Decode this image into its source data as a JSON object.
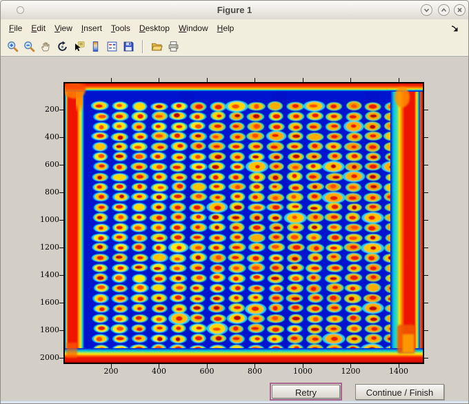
{
  "window": {
    "title": "Figure 1",
    "controls": {
      "menu": "window-menu",
      "minimize": "minimize",
      "maximize": "maximize",
      "close": "close"
    }
  },
  "menubar": {
    "items": [
      "File",
      "Edit",
      "View",
      "Insert",
      "Tools",
      "Desktop",
      "Window",
      "Help"
    ],
    "overflow": "dock-figure-arrow"
  },
  "toolbar": {
    "group1": [
      "zoom-in",
      "zoom-out",
      "pan",
      "rotate-3d",
      "data-cursor",
      "insert-colorbar",
      "insert-legend",
      "save-figure"
    ],
    "group2": [
      "open-file",
      "print-figure"
    ]
  },
  "plot": {
    "x_ticks": [
      200,
      400,
      600,
      800,
      1000,
      1200,
      1400
    ],
    "y_ticks": [
      200,
      400,
      600,
      800,
      1000,
      1200,
      1400,
      1600,
      1800,
      2000
    ],
    "grid": {
      "cols": 16,
      "rows": 25
    },
    "colors": {
      "background": "#0014d0",
      "halo": [
        "#00d2f0",
        "#16dcd4",
        "#2fe0b4",
        "#52e292",
        "#7ce66e"
      ],
      "ring": [
        "#ffe80a",
        "#ffd800",
        "#ffc400",
        "#ffae00",
        "#ff9a00"
      ],
      "core_red": "#e81c00",
      "core_dark": "#bb0600",
      "core_hot": "#ff4e00",
      "edge_red": "#ee1400",
      "edge_orange": "#ff9000",
      "edge_yellow": "#ffe000",
      "edge_cyan": "#00c8e0"
    }
  },
  "chart_data": {
    "type": "heatmap",
    "title": "",
    "xlabel": "",
    "ylabel": "",
    "x_ticks": [
      200,
      400,
      600,
      800,
      1000,
      1200,
      1400
    ],
    "y_ticks": [
      200,
      400,
      600,
      800,
      1000,
      1200,
      1400,
      1600,
      1800,
      2000
    ],
    "x_range": [
      1,
      1500
    ],
    "y_range": [
      1,
      2040
    ],
    "colormap": "jet",
    "content": "Scanned microarray plate image: roughly 16 x 25 grid of spots with red/orange cores, yellow rings and cyan-green halos on a deep blue background; saturated red bands along all four edges of the scan"
  },
  "actions": {
    "retry_label": "Retry",
    "continue_label": "Continue / Finish"
  },
  "accent": {
    "focus_ring": "#a8638e"
  }
}
